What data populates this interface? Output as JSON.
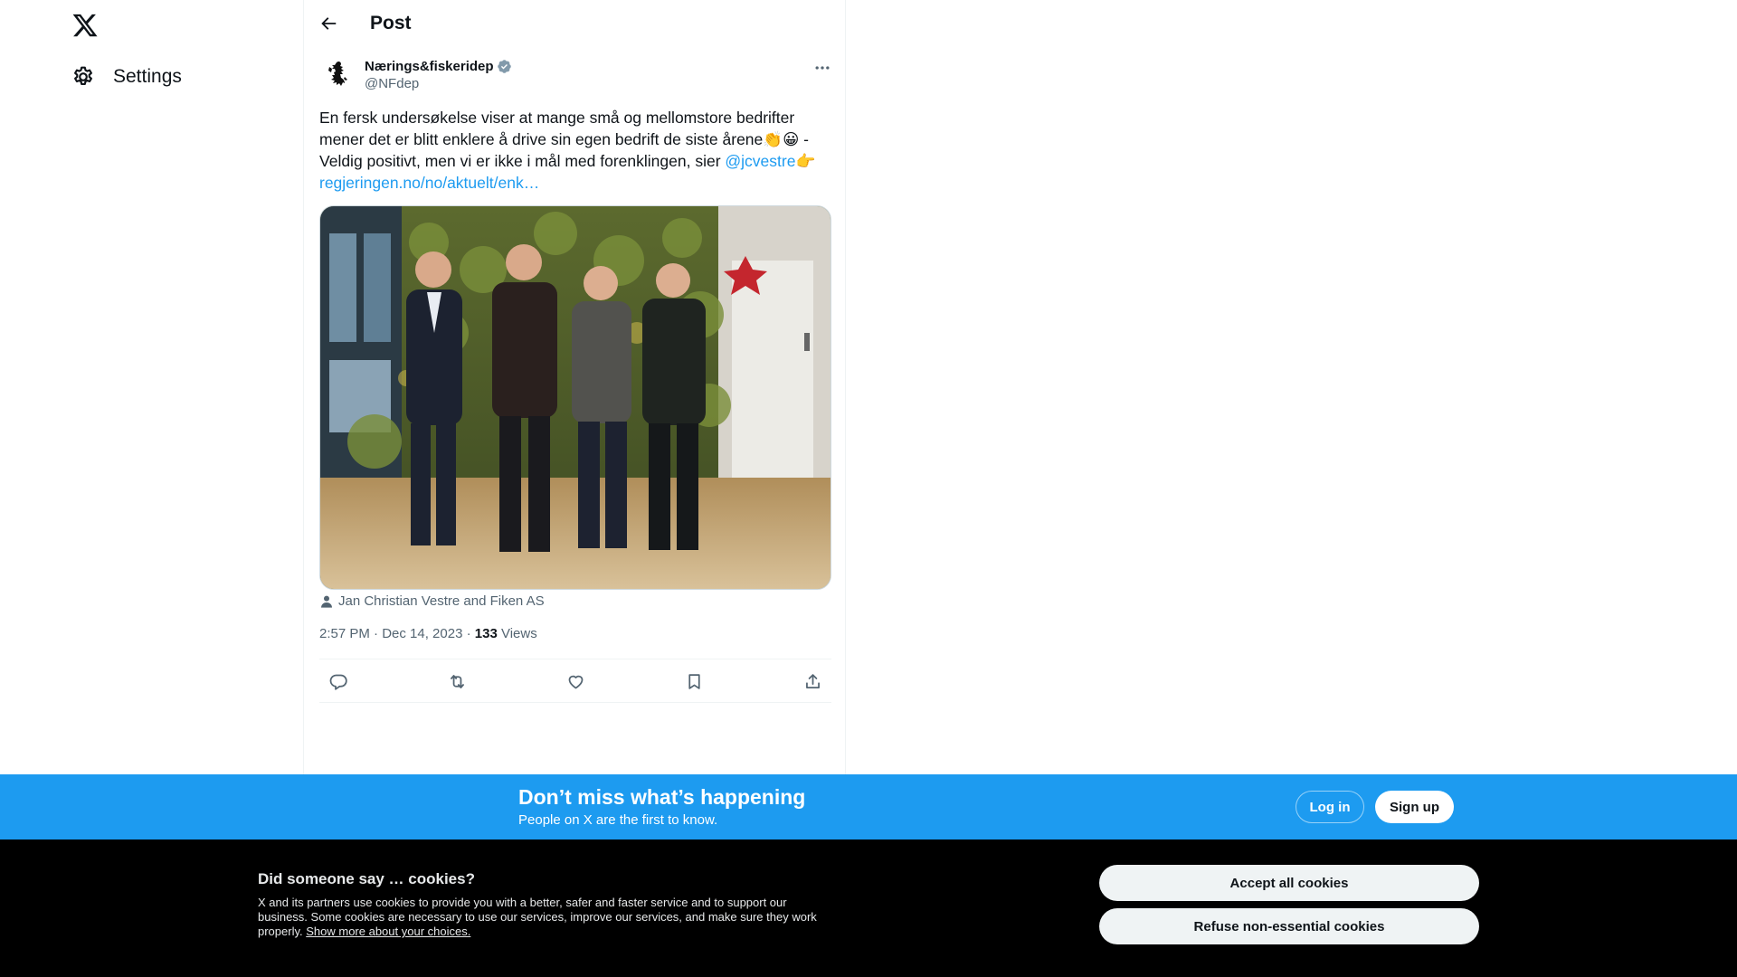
{
  "nav": {
    "settings_label": "Settings"
  },
  "header": {
    "title": "Post"
  },
  "tweet": {
    "display_name": "Nærings&fiskeridep",
    "handle": "@NFdep",
    "text_part1": "En fersk undersøkelse viser at mange små og mellomstore bedrifter mener det er blitt enklere å drive sin egen bedrift de siste årene👏😀 - Veldig positivt, men vi er ikke i mål med forenklingen, sier ",
    "mention": "@jcvestre",
    "mention_suffix": "👉",
    "link": "regjeringen.no/no/aktuelt/enk…",
    "tagged": "Jan Christian Vestre and Fiken AS",
    "timestamp": "2:57 PM · Dec 14, 2023",
    "separator": " · ",
    "views_count": "133",
    "views_label": "Views"
  },
  "banner": {
    "title": "Don’t miss what’s happening",
    "subtitle": "People on X are the first to know.",
    "login_label": "Log in",
    "signup_label": "Sign up"
  },
  "cookies": {
    "title": "Did someone say … cookies?",
    "body": "X and its partners use cookies to provide you with a better, safer and faster service and to support our business. Some cookies are necessary to use our services, improve our services, and make sure they work properly. ",
    "more_link": "Show more about your choices.",
    "accept_label": "Accept all cookies",
    "refuse_label": "Refuse non-essential cookies"
  },
  "icons": {
    "logo": "x-logo-icon",
    "settings": "gear-icon",
    "back": "arrow-left-icon",
    "more": "more-dots-icon",
    "verified": "verified-badge-icon",
    "tagged": "person-icon",
    "reply": "reply-icon",
    "repost": "repost-icon",
    "like": "heart-icon",
    "bookmark": "bookmark-icon",
    "share": "share-icon"
  },
  "colors": {
    "accent": "#1d9bf0",
    "text": "#0f1419",
    "secondary": "#536471",
    "cookie_bg": "#000000",
    "verified": "#829aab"
  }
}
